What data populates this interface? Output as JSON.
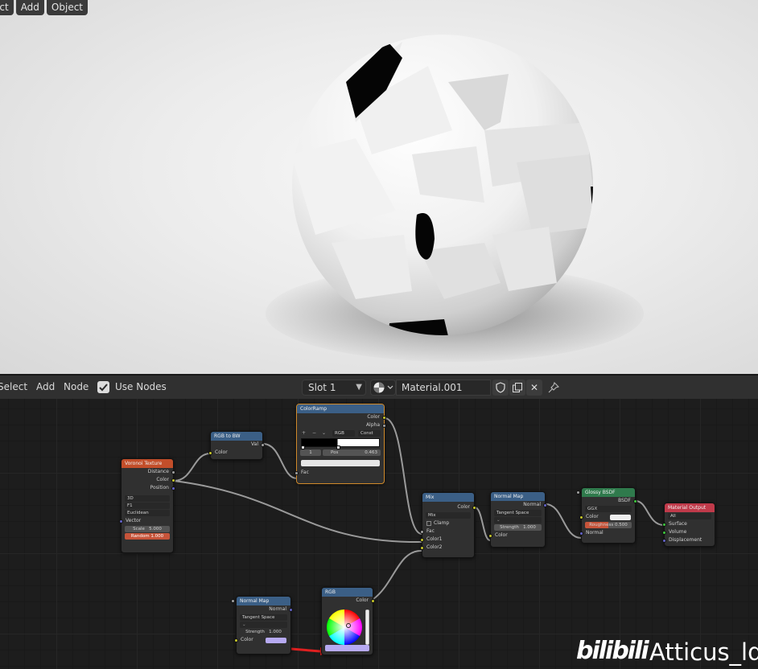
{
  "viewport_menu": [
    "ect",
    "Add",
    "Object"
  ],
  "node_editor_header": {
    "menus": [
      "Select",
      "Add",
      "Node"
    ],
    "use_nodes_label": "Use Nodes",
    "slot": "Slot 1",
    "material_name": "Material.001"
  },
  "nodes": {
    "voronoi": {
      "title": "Voronoi Texture",
      "outputs": [
        "Distance",
        "Color",
        "Position"
      ],
      "dims": "3D",
      "feature": "F1",
      "metric": "Euclidean",
      "vector_label": "Vector",
      "scale_label": "Scale",
      "scale_value": "5.000",
      "randomness": "Random 1.000"
    },
    "rgb_to_bw": {
      "title": "RGB to BW",
      "output": "Val",
      "input": "Color"
    },
    "color_ramp": {
      "title": "ColorRamp",
      "outputs": [
        "Color",
        "Alpha"
      ],
      "mode": "RGB",
      "interp": "Const",
      "index": "1",
      "pos_label": "Pos",
      "pos_value": "0.463",
      "input": "Fac"
    },
    "mix": {
      "title": "Mix",
      "output": "Color",
      "blend": "Mix",
      "clamp_label": "Clamp",
      "inputs": [
        "Fac",
        "Color1",
        "Color2"
      ]
    },
    "normal_map_1": {
      "title": "Normal Map",
      "output": "Normal",
      "space": "Tangent Space",
      "strength_label": "Strength",
      "strength_value": "1.000",
      "input": "Color"
    },
    "glossy": {
      "title": "Glossy BSDF",
      "output": "BSDF",
      "distribution": "GGX",
      "color_label": "Color",
      "roughness_label": "Roughness",
      "roughness_value": "0.500",
      "normal_label": "Normal"
    },
    "output": {
      "title": "Material Output",
      "target": "All",
      "inputs": [
        "Surface",
        "Volume",
        "Displacement"
      ]
    },
    "normal_map_2": {
      "title": "Normal Map",
      "output": "Normal",
      "space": "Tangent Space",
      "strength_label": "Strength",
      "strength_value": "1.000",
      "input": "Color"
    },
    "rgb": {
      "title": "RGB",
      "output": "Color"
    }
  },
  "watermark": {
    "logo": "bilibili",
    "name": "Atticus_ld"
  },
  "colors": {
    "voronoi_header": "#c24e2a",
    "converter_header": "#3b5f86",
    "shader_header": "#2f7a4c",
    "output_header": "#c03a4a",
    "selected_border": "#d08a2a",
    "rgb_value": "#b7aaf2",
    "arrow": "#e02020"
  }
}
